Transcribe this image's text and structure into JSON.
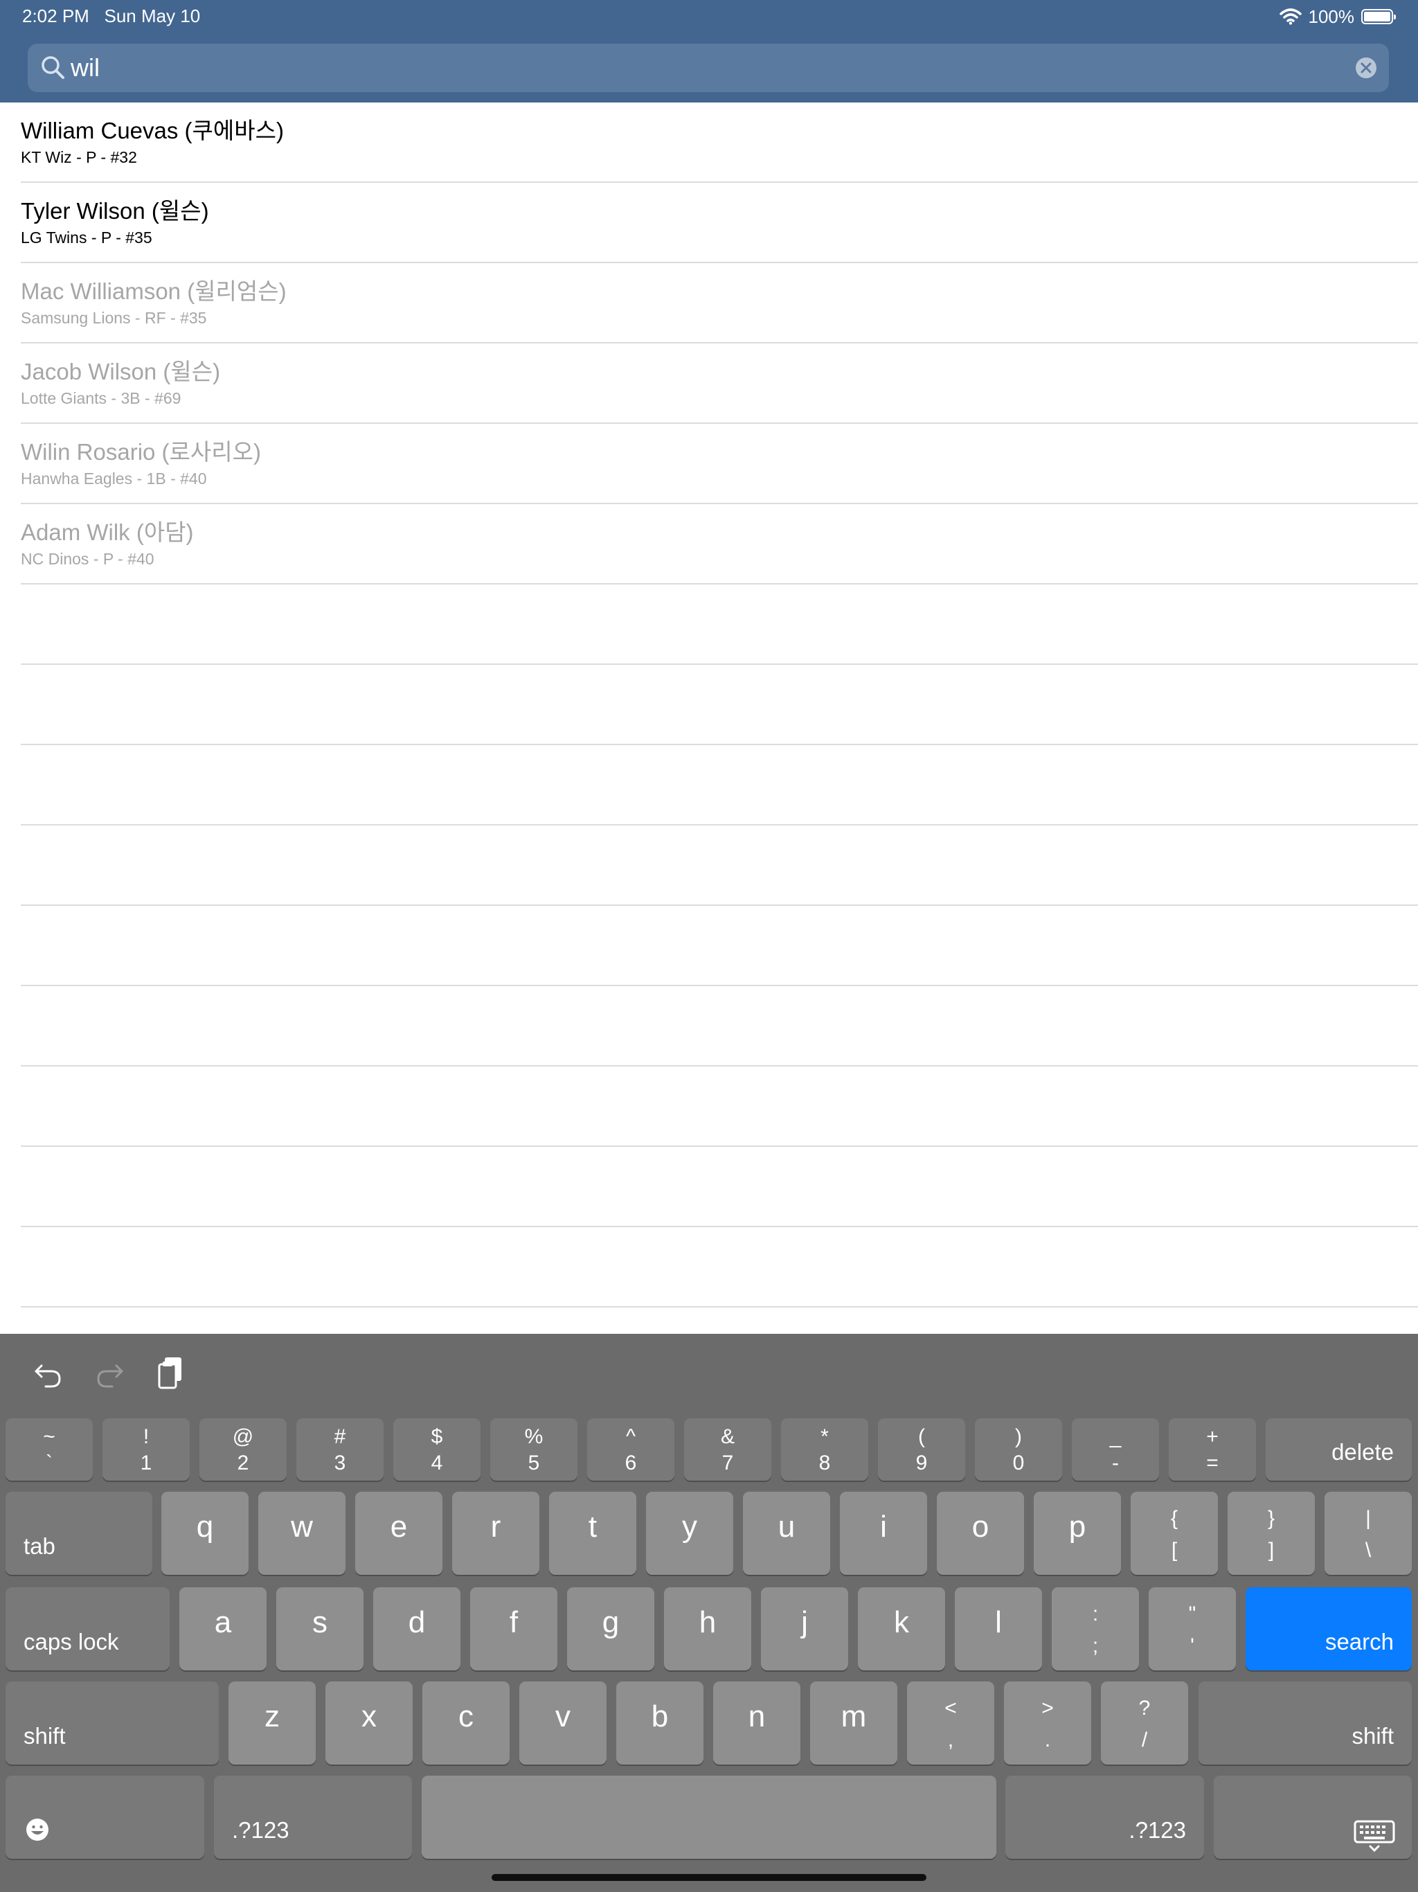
{
  "status_bar": {
    "time": "2:02 PM",
    "date": "Sun May 10",
    "battery_percent": "100%",
    "battery_level": 1.0
  },
  "search": {
    "query": "wil",
    "placeholder": ""
  },
  "results": [
    {
      "name": "William Cuevas (쿠에바스)",
      "detail": "KT Wiz - P - #32",
      "dimmed": false
    },
    {
      "name": "Tyler Wilson (윌슨)",
      "detail": "LG Twins - P - #35",
      "dimmed": false
    },
    {
      "name": "Mac Williamson (윌리엄슨)",
      "detail": "Samsung Lions - RF - #35",
      "dimmed": true
    },
    {
      "name": "Jacob Wilson (윌슨)",
      "detail": "Lotte Giants - 3B - #69",
      "dimmed": true
    },
    {
      "name": "Wilin Rosario (로사리오)",
      "detail": "Hanwha Eagles - 1B - #40",
      "dimmed": true
    },
    {
      "name": "Adam Wilk (아담)",
      "detail": "NC Dinos - P - #40",
      "dimmed": true
    }
  ],
  "keyboard": {
    "number_row": [
      {
        "top": "~",
        "bottom": "`"
      },
      {
        "top": "!",
        "bottom": "1"
      },
      {
        "top": "@",
        "bottom": "2"
      },
      {
        "top": "#",
        "bottom": "3"
      },
      {
        "top": "$",
        "bottom": "4"
      },
      {
        "top": "%",
        "bottom": "5"
      },
      {
        "top": "^",
        "bottom": "6"
      },
      {
        "top": "&",
        "bottom": "7"
      },
      {
        "top": "*",
        "bottom": "8"
      },
      {
        "top": "(",
        "bottom": "9"
      },
      {
        "top": ")",
        "bottom": "0"
      },
      {
        "top": "_",
        "bottom": "-"
      },
      {
        "top": "+",
        "bottom": "="
      }
    ],
    "delete_label": "delete",
    "tab_label": "tab",
    "row_q": [
      "q",
      "w",
      "e",
      "r",
      "t",
      "y",
      "u",
      "i",
      "o",
      "p"
    ],
    "row_q_symbols": [
      {
        "top": "{",
        "bottom": "["
      },
      {
        "top": "}",
        "bottom": "]"
      },
      {
        "top": "|",
        "bottom": "\\"
      }
    ],
    "caps_lock_label": "caps lock",
    "row_a": [
      "a",
      "s",
      "d",
      "f",
      "g",
      "h",
      "j",
      "k",
      "l"
    ],
    "row_a_symbols": [
      {
        "top": ":",
        "bottom": ";"
      },
      {
        "top": "\"",
        "bottom": "'"
      }
    ],
    "search_label": "search",
    "shift_label": "shift",
    "row_z": [
      "z",
      "x",
      "c",
      "v",
      "b",
      "n",
      "m"
    ],
    "row_z_symbols": [
      {
        "top": "<",
        "bottom": ","
      },
      {
        "top": ">",
        "bottom": "."
      },
      {
        "top": "?",
        "bottom": "/"
      }
    ],
    "numbers_label": ".?123",
    "accent_color": "#0a7cff"
  },
  "icons": {
    "search": "search-icon",
    "clear": "clear-icon",
    "wifi": "wifi-icon",
    "battery": "battery-icon",
    "undo": "undo-icon",
    "redo": "redo-icon",
    "paste": "paste-icon",
    "emoji": "emoji-icon",
    "dismiss_keyboard": "keyboard-dismiss-icon"
  }
}
